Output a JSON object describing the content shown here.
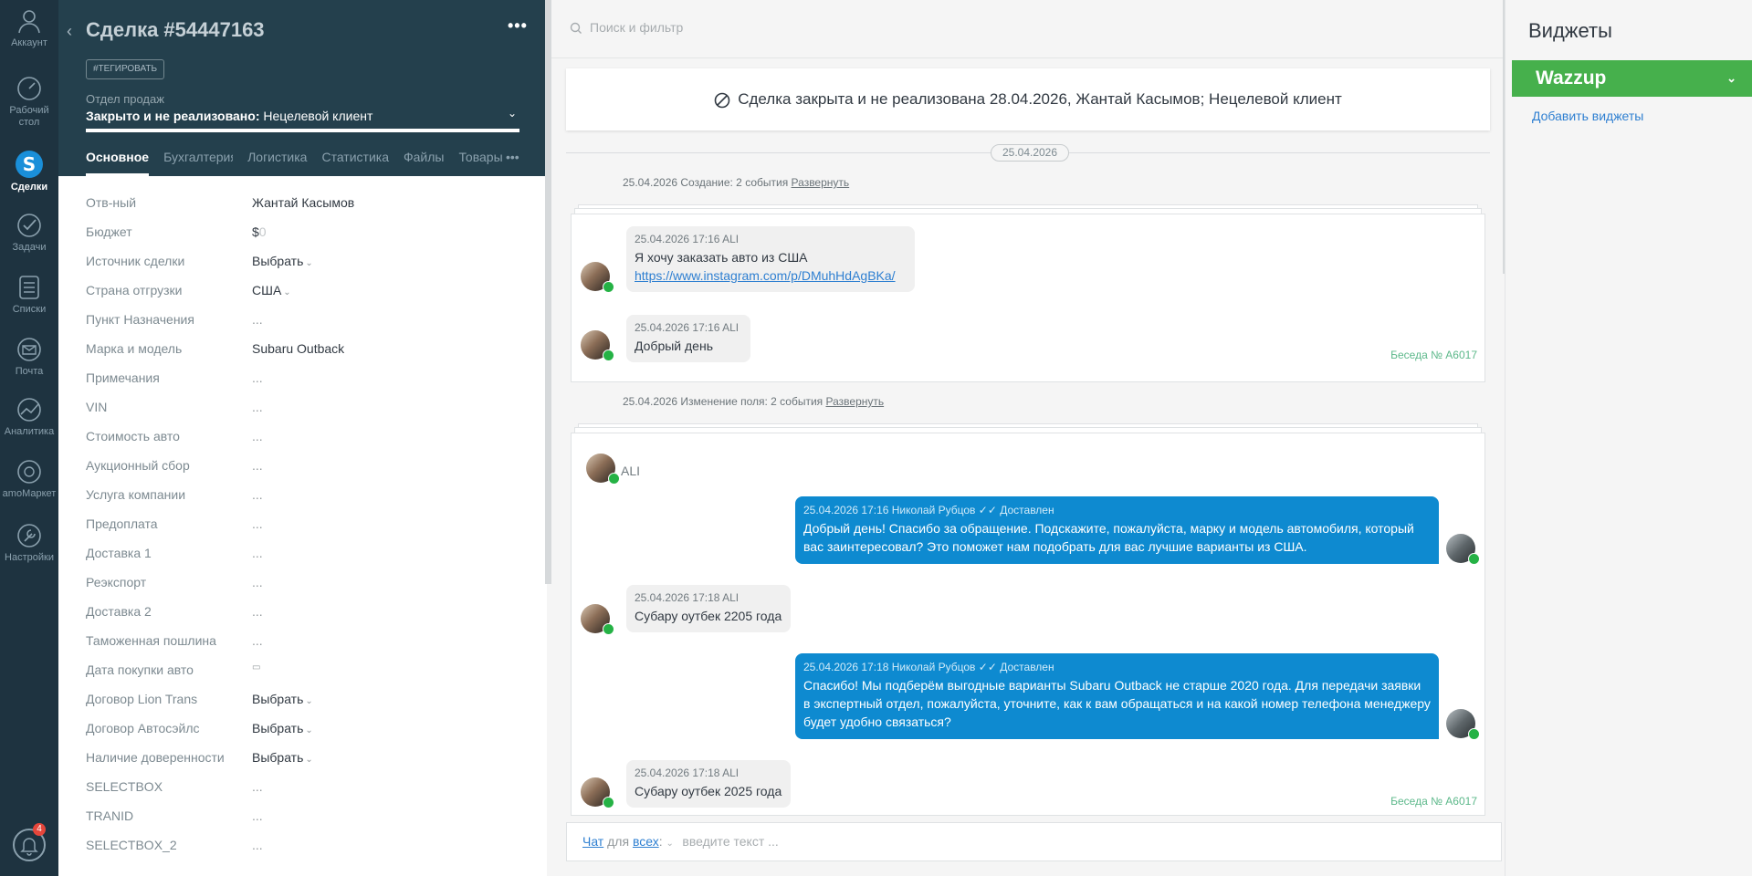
{
  "nav": {
    "items": [
      {
        "label": "Аккаунт",
        "icon": "user-icon"
      },
      {
        "label": "Рабочий стол",
        "icon": "dashboard-icon"
      },
      {
        "label": "Сделки",
        "icon": "deals-icon"
      },
      {
        "label": "Задачи",
        "icon": "tasks-icon"
      },
      {
        "label": "Списки",
        "icon": "lists-icon"
      },
      {
        "label": "Почта",
        "icon": "mail-icon"
      },
      {
        "label": "Аналитика",
        "icon": "analytics-icon"
      },
      {
        "label": "amoМаркет",
        "icon": "market-icon"
      },
      {
        "label": "Настройки",
        "icon": "settings-icon"
      }
    ],
    "notifications_count": "4"
  },
  "deal": {
    "title": "Сделка #54447163",
    "more": "•••",
    "tag_button": "#ТЕГИРОВАТЬ",
    "pipeline": "Отдел продаж",
    "status": "Закрыто и не реализовано:",
    "status_reason": "Нецелевой клиент",
    "tabs": [
      "Основное",
      "Бухгалтерия",
      "Логистика",
      "Статистика",
      "Файлы",
      "Товары"
    ],
    "tabs_more": "•••",
    "fields": [
      {
        "label": "Отв-ный",
        "value": "Жантай Касымов"
      },
      {
        "label": "Бюджет",
        "value": "$",
        "extra": "0"
      },
      {
        "label": "Источник сделки",
        "value": "Выбрать",
        "select": true
      },
      {
        "label": "Страна отгрузки",
        "value": "США",
        "select": true
      },
      {
        "label": "Пункт Назначения",
        "value": "...",
        "placeholder": true
      },
      {
        "label": "Марка и модель",
        "value": "Subaru Outback"
      },
      {
        "label": "Примечания",
        "value": "...",
        "placeholder": true
      },
      {
        "label": "VIN",
        "value": "...",
        "placeholder": true
      },
      {
        "label": "Стоимость авто",
        "value": "...",
        "placeholder": true
      },
      {
        "label": "Аукционный сбор",
        "value": "...",
        "placeholder": true
      },
      {
        "label": "Услуга компании",
        "value": "...",
        "placeholder": true
      },
      {
        "label": "Предоплата",
        "value": "...",
        "placeholder": true
      },
      {
        "label": "Доставка 1",
        "value": "...",
        "placeholder": true
      },
      {
        "label": "Реэкспорт",
        "value": "...",
        "placeholder": true
      },
      {
        "label": "Доставка 2",
        "value": "...",
        "placeholder": true
      },
      {
        "label": "Таможенная пошлина",
        "value": "...",
        "placeholder": true
      },
      {
        "label": "Дата покупки авто",
        "value": "▭",
        "placeholder": true
      },
      {
        "label": "Договор Lion Trans",
        "value": "Выбрать",
        "select": true
      },
      {
        "label": "Договор Автосэйлс",
        "value": "Выбрать",
        "select": true
      },
      {
        "label": "Наличие доверенности",
        "value": "Выбрать",
        "select": true
      },
      {
        "label": "SELECTBOX",
        "value": "...",
        "placeholder": true
      },
      {
        "label": "TRANID",
        "value": "...",
        "placeholder": true
      },
      {
        "label": "SELECTBOX_2",
        "value": "...",
        "placeholder": true
      }
    ]
  },
  "feed": {
    "search_placeholder": "Поиск и фильтр",
    "closed_banner": "Сделка закрыта и не реализована 28.04.2026, Жантай Касымов; Нецелевой клиент",
    "date_pill": "25.04.2026",
    "events": [
      {
        "text": "25.04.2026 Создание: 2 события",
        "expand": "Развернуть"
      },
      {
        "text": "25.04.2026 Изменение поля: 2 события",
        "expand": "Развернуть"
      }
    ],
    "convo1": {
      "messages": [
        {
          "meta": "25.04.2026 17:16 ALI",
          "text": "Я хочу заказать авто из США",
          "link": "https://www.instagram.com/p/DMuhHdAgBKa/"
        },
        {
          "meta": "25.04.2026 17:16 ALI",
          "text": "Добрый день"
        }
      ],
      "number": "Беседа № A6017"
    },
    "convo2": {
      "contact": "ALI",
      "messages": [
        {
          "dir": "out",
          "meta": "25.04.2026 17:16 Николай Рубцов",
          "status": "✓✓ Доставлен",
          "text": "Добрый день! Спасибо за обращение. Подскажите, пожалуйста, марку и модель автомобиля, который вас заинтересовал? Это поможет нам подобрать для вас лучшие варианты из США."
        },
        {
          "dir": "in",
          "meta": "25.04.2026 17:18 ALI",
          "text": "Субару оутбек 2205 года"
        },
        {
          "dir": "out",
          "meta": "25.04.2026 17:18 Николай Рубцов",
          "status": "✓✓ Доставлен",
          "text": "Спасибо! Мы подберём выгодные варианты Subaru Outback не старше 2020 года. Для передачи заявки в экспертный отдел, пожалуйста, уточните, как к вам обращаться и на какой номер телефона менеджеру будет удобно связаться?"
        },
        {
          "dir": "in",
          "meta": "25.04.2026 17:18 ALI",
          "text": "Субару оутбек 2025 года"
        }
      ],
      "number": "Беседа № A6017"
    },
    "composer": {
      "chat_link": "Чат",
      "for_text": "для",
      "all_link": "всех",
      "colon": ":",
      "placeholder": "введите текст ..."
    }
  },
  "widgets": {
    "title": "Виджеты",
    "wazzup": "Wazzup",
    "add": "Добавить виджеты"
  },
  "colors": {
    "nav_bg": "#1e3340",
    "card_head_bg": "#24404d",
    "outgoing_bubble": "#0e8ad0",
    "wazzup_green": "#46b04c",
    "whatsapp_green": "#25b245"
  }
}
